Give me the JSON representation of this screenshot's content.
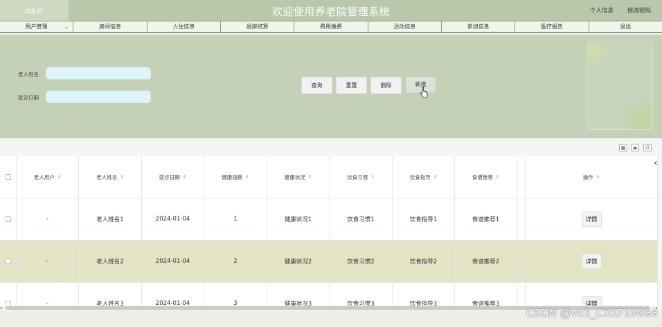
{
  "header": {
    "home_label": "Ω主页",
    "title": "欢迎使用养老院管理系统",
    "personal_info": "个人信息",
    "change_password": "修改密码"
  },
  "nav": {
    "items": [
      {
        "label": "用户管理"
      },
      {
        "label": "房间信息"
      },
      {
        "label": "入住信息"
      },
      {
        "label": "退房结算"
      },
      {
        "label": "费用缴费"
      },
      {
        "label": "活动信息"
      },
      {
        "label": "参加信息"
      },
      {
        "label": "医疗报告"
      },
      {
        "label": "退出"
      }
    ]
  },
  "search": {
    "name_label": "老人姓名",
    "date_label": "就诊日期",
    "name_value": "",
    "date_value": "",
    "buttons": {
      "query": "查询",
      "reset": "重置",
      "delete": "删除",
      "add": "新增"
    }
  },
  "table": {
    "columns": [
      "老人用户",
      "老人姓名",
      "就诊日期",
      "健康指数",
      "健康状况",
      "饮食习惯",
      "饮食指导",
      "食谱推荐",
      "操作"
    ],
    "rows": [
      {
        "user": "-",
        "name": "老人姓名1",
        "date": "2024-01-04",
        "index": "1",
        "status": "健康状况1",
        "habit": "饮食习惯1",
        "guide": "饮食指导1",
        "recipe": "食谱推荐1",
        "action": "详情"
      },
      {
        "user": "-",
        "name": "老人姓名2",
        "date": "2024-01-04",
        "index": "2",
        "status": "健康状况2",
        "habit": "饮食习惯2",
        "guide": "饮食指导2",
        "recipe": "食谱推荐2",
        "action": "详情"
      },
      {
        "user": "-",
        "name": "老人姓名3",
        "date": "2024-01-04",
        "index": "3",
        "status": "健康状况3",
        "habit": "饮食习惯3",
        "guide": "饮食指导3",
        "recipe": "食谱推荐3",
        "action": "详情"
      }
    ]
  },
  "watermark": "CSDN @vx2_CXKF10088",
  "colors": {
    "header_bg": "#b9c7aa",
    "panel_bg": "#c4d1b6",
    "row_highlight": "#e3e4c5",
    "input_bg": "#ddf4f8"
  }
}
